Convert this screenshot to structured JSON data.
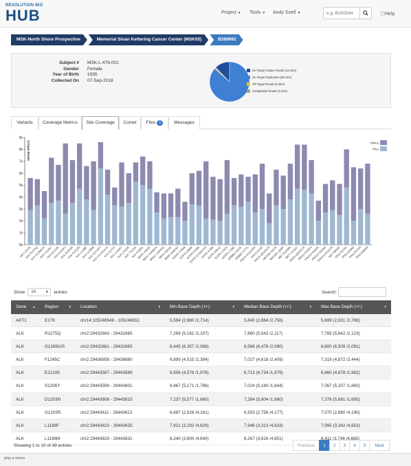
{
  "app": {
    "logo_top": "RESOLUTION BIO",
    "logo_main": "HUB"
  },
  "nav": {
    "project": "Project",
    "tools": "Tools",
    "user": "Andy Soell",
    "search_placeholder": "e.g. B200544",
    "help": "Help"
  },
  "breadcrumb": [
    "MSK-North Shore Prospective",
    "Memorial Sloan Kettering Cancer Center (MSK05)",
    "B389992"
  ],
  "subject": {
    "rows": [
      {
        "label": "Subject #",
        "value": "MSK-L-476-001"
      },
      {
        "label": "Gender",
        "value": "Female"
      },
      {
        "label": "Year of Birth",
        "value": "1935"
      },
      {
        "label": "Collected On",
        "value": "07-Sep-2018"
      }
    ]
  },
  "pie": {
    "slices": [
      {
        "label": "On Target Unique Reads (12.23%)",
        "value": 12.23,
        "color": "#1f4e9c"
      },
      {
        "label": "On Target Duplicates (86.54%)",
        "value": 86.54,
        "color": "#3f7fd4"
      },
      {
        "label": "Off Target Reads (0.86%)",
        "value": 0.86,
        "color": "#f0c22a"
      },
      {
        "label": "Unalignable Reads (0.34%)",
        "value": 0.34,
        "color": "#9e9e9e"
      }
    ]
  },
  "tabs": [
    {
      "label": "Variants",
      "badge": ""
    },
    {
      "label": "Coverage Metrics",
      "badge": ""
    },
    {
      "label": "Site Coverage",
      "badge": "",
      "active": true
    },
    {
      "label": "Comet",
      "badge": ""
    },
    {
      "label": "Files",
      "badge": "1"
    },
    {
      "label": "Messages",
      "badge": ""
    }
  ],
  "chart_data": {
    "type": "bar",
    "stacked": true,
    "ylabel": "Unique Reads",
    "ylim": [
      0,
      9000
    ],
    "yticks": [
      "0k",
      "1k",
      "2k",
      "3k",
      "4k",
      "5k",
      "6k",
      "7k",
      "8k",
      "9k"
    ],
    "legend_placement": "top-right",
    "series": [
      {
        "name": "Minus",
        "color": "#8c8aaf"
      },
      {
        "name": "Plus",
        "color": "#9fb7d1"
      }
    ],
    "categories": [
      "AKT1 E17K",
      "ALK R1275Q",
      "ALK G1269A/S",
      "ALK F1245C",
      "ALK E1210K",
      "ALK S1206Y",
      "ALK D1203N",
      "ALK G1202R",
      "ALK L1198F",
      "ALK L1196M",
      "ALK I1171N/T",
      "ALK F1174C/L/V",
      "ALK I1171S",
      "ALK C1156Y",
      "ALK L1152R",
      "ALK T1151K",
      "ALK V1180L",
      "BRAF V600E",
      "BRAF G469A/V",
      "BRAF L597R/Q",
      "BRAF K601E",
      "BRAF N581S/I",
      "EGFR T790M",
      "EGFR L858R",
      "EGFR E709K",
      "EGFR G719A/C/S",
      "EGFR S768I",
      "EGFR L861Q",
      "EGFR C797S",
      "EGFR L718Q",
      "ERBB2 S310F",
      "ERBB2 V777L",
      "KRAS G12C/D/V",
      "KRAS G13D",
      "KRAS Q61H/L/R",
      "MAP2K1 K57N",
      "MAP2K1 Q56P",
      "MET D1228N",
      "MET Y1230C",
      "NRAS Q61K/L/R",
      "NRAS G12D/V",
      "PIK3CA E542K",
      "PIK3CA E545K",
      "PIK3CA H1047R",
      "RET M918T",
      "TP53 R175H",
      "TP53 R248Q",
      "TP53 R273H",
      "TP53 R282W"
    ],
    "plus": [
      2900,
      3300,
      2200,
      3500,
      3700,
      2600,
      3500,
      4700,
      3800,
      2900,
      6400,
      4200,
      3300,
      3200,
      3500,
      5300,
      5000,
      4700,
      2700,
      2200,
      2300,
      2300,
      2000,
      3400,
      3300,
      2200,
      2100,
      2000,
      2600,
      3300,
      3200,
      3600,
      2700,
      3000,
      1800,
      3300,
      3000,
      3800,
      4700,
      4600,
      4300,
      2000,
      2700,
      2900,
      2500,
      4800,
      2000,
      3000,
      2600
    ],
    "minus": [
      2700,
      2200,
      2300,
      3800,
      3000,
      5900,
      3600,
      3800,
      2800,
      4100,
      2200,
      2100,
      1500,
      3700,
      2500,
      1600,
      2400,
      2300,
      1700,
      2100,
      2000,
      2400,
      1600,
      2600,
      2900,
      4800,
      3600,
      3500,
      4500,
      2300,
      2700,
      2100,
      3200,
      3800,
      2500,
      3000,
      2800,
      3000,
      3700,
      3800,
      2800,
      1700,
      2400,
      2500,
      2600,
      3200,
      4500,
      3400,
      4200
    ]
  },
  "table_controls": {
    "show_label": "Show",
    "page_size": "10",
    "entries_label": "entries",
    "search_label": "Search:"
  },
  "table": {
    "headers": [
      "Gene",
      "Region",
      "Location",
      "Min Base Depth (+/-)",
      "Median Base Depth (+/-)",
      "Max Base Depth (+/-)"
    ],
    "rows": [
      [
        "AKT1",
        "E17K",
        "chr14:105246549 - 105246551",
        "5,594 (2,880 /2,714)",
        "5,640 (2,884 /2,756)",
        "5,699 (2,931 /2,768)"
      ],
      [
        "ALK",
        "R1275Q",
        "chr2:29432663 - 29432665",
        "7,269 (5,162 /2,107)",
        "7,660 (5,543 /2,117)",
        "7,765 (5,642 /2,123)"
      ],
      [
        "ALK",
        "G1269A/S",
        "chr2:29432681 - 29432683",
        "8,445 (6,357 /2,088)",
        "8,568 (6,478 /2,090)",
        "8,600 (6,509 /2,091)"
      ],
      [
        "ALK",
        "F1245C",
        "chr2:29436858 - 29436860",
        "6,899 (4,515 /2,384)",
        "7,027 (4,618 /2,409)",
        "7,316 (4,872 /2,444)"
      ],
      [
        "ALK",
        "E1210K",
        "chr2:29443587 - 29443589",
        "6,556 (4,578 /1,978)",
        "6,713 (4,734 /1,979)",
        "6,860 (4,878 /1,982)"
      ],
      [
        "ALK",
        "S1206Y",
        "chr2:29443599 - 29443601",
        "6,967 (5,171 /1,796)",
        "7,024 (5,180 /1,844)",
        "7,067 (5,207 /1,860)"
      ],
      [
        "ALK",
        "D1203N",
        "chr2:29443608 - 29443610",
        "7,237 (5,577 /1,660)",
        "7,264 (5,604 /1,660)",
        "7,376 (5,681 /1,695)"
      ],
      [
        "ALK",
        "G1202R",
        "chr2:29443611 - 29443613",
        "6,687 (2,526 /4,161)",
        "6,933 (2,756 /4,177)",
        "7,070 (2,880 /4,190)"
      ],
      [
        "ALK",
        "L1198F",
        "chr2:29443623 - 29443625",
        "7,921 (3,292 /4,629)",
        "7,946 (3,313 /4,633)",
        "7,995 (3,342 /4,653)"
      ],
      [
        "ALK",
        "L1196M",
        "chr2:29443629 - 29443631",
        "8,240 (3,600 /4,640)",
        "8,267 (3,616 /4,651)",
        "8,411 (3,746 /4,665)"
      ]
    ]
  },
  "footer": {
    "showing": "Showing 1 to 10 of 49 entries",
    "pages": [
      "Previous",
      "1",
      "2",
      "3",
      "4",
      "5",
      "Next"
    ],
    "status": "play a menu"
  }
}
